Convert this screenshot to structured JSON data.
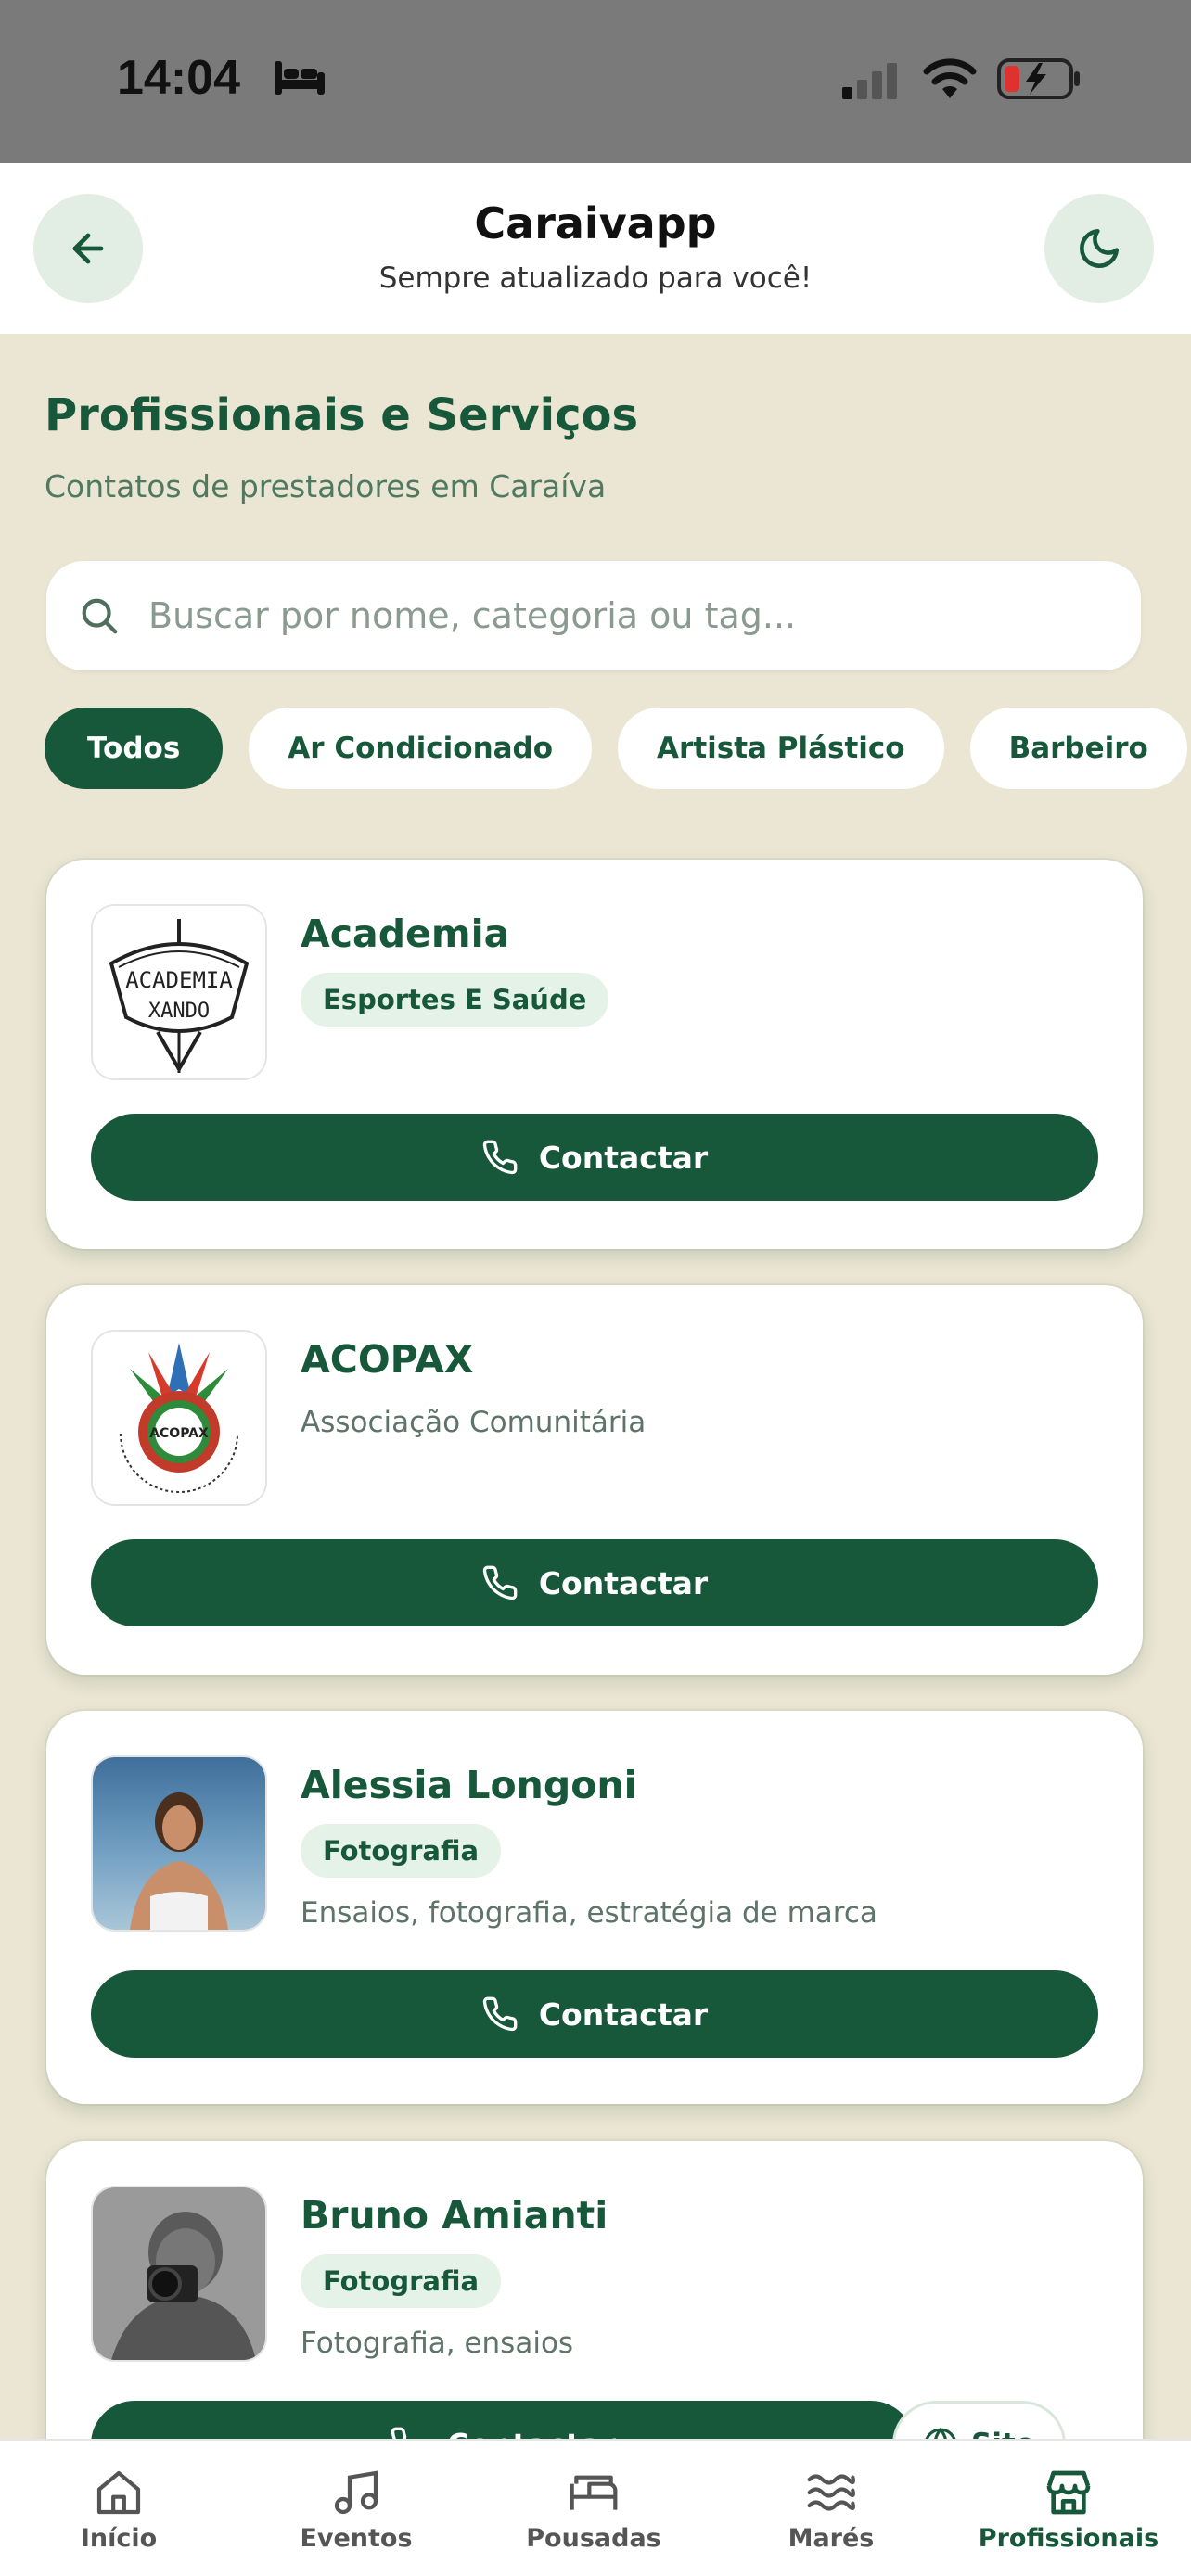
{
  "status_bar": {
    "time": "14:04"
  },
  "header": {
    "title": "Caraivapp",
    "subtitle": "Sempre atualizado para você!"
  },
  "page": {
    "title": "Profissionais e Serviços",
    "subtitle": "Contatos de prestadores em Caraíva"
  },
  "search": {
    "placeholder": "Buscar por nome, categoria ou tag..."
  },
  "chips": [
    {
      "label": "Todos",
      "active": true
    },
    {
      "label": "Ar Condicionado",
      "active": false
    },
    {
      "label": "Artista Plástico",
      "active": false
    },
    {
      "label": "Barbeiro",
      "active": false
    }
  ],
  "cards": [
    {
      "name": "Academia",
      "tag": "Esportes E Saúde",
      "description": "",
      "logo_text": "ACADEMIA XANDO",
      "contact_label": "Contactar"
    },
    {
      "name": "ACOPAX",
      "tag": "",
      "description": "Associação Comunitária",
      "logo_text": "ACOPAX",
      "contact_label": "Contactar"
    },
    {
      "name": "Alessia Longoni",
      "tag": "Fotografia",
      "description": "Ensaios, fotografia, estratégia de marca",
      "contact_label": "Contactar"
    },
    {
      "name": "Bruno Amianti",
      "tag": "Fotografia",
      "description": "Fotografia, ensaios",
      "contact_label": "Contactar",
      "site_label": "Site"
    }
  ],
  "bottom_nav": [
    {
      "label": "Início",
      "icon": "home-icon",
      "active": false
    },
    {
      "label": "Eventos",
      "icon": "music-icon",
      "active": false
    },
    {
      "label": "Pousadas",
      "icon": "bed-icon",
      "active": false
    },
    {
      "label": "Marés",
      "icon": "waves-icon",
      "active": false
    },
    {
      "label": "Profissionais",
      "icon": "store-icon",
      "active": true
    }
  ],
  "colors": {
    "primary": "#17573a",
    "background": "#ebe5d3",
    "tag_bg": "#e5f2e7"
  }
}
